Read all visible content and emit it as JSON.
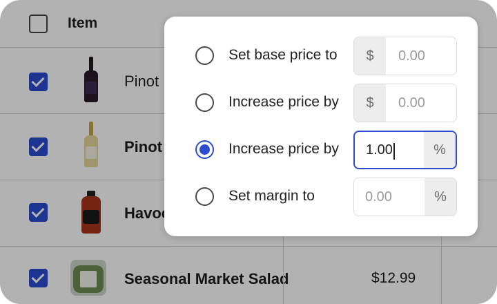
{
  "table": {
    "column_title": "Item",
    "rows": [
      {
        "name": "Pinot",
        "price": "",
        "checked": true
      },
      {
        "name": "Pinot",
        "price": "",
        "checked": true
      },
      {
        "name": "Havoc",
        "price": "",
        "checked": true
      },
      {
        "name": "Seasonal Market Salad",
        "price": "$12.99",
        "checked": true
      }
    ]
  },
  "modal": {
    "options": [
      {
        "label": "Set base price to",
        "adornment": "$",
        "adornment_side": "left",
        "value": "",
        "placeholder": "0.00",
        "selected": false
      },
      {
        "label": "Increase price by",
        "adornment": "$",
        "adornment_side": "left",
        "value": "",
        "placeholder": "0.00",
        "selected": false
      },
      {
        "label": "Increase price by",
        "adornment": "%",
        "adornment_side": "right",
        "value": "1.00",
        "placeholder": "",
        "selected": true
      },
      {
        "label": "Set margin to",
        "adornment": "%",
        "adornment_side": "right",
        "value": "",
        "placeholder": "0.00",
        "selected": false
      }
    ]
  },
  "colors": {
    "accent": "#2c4bd0",
    "overlay": "rgba(0,0,0,0.30)"
  }
}
